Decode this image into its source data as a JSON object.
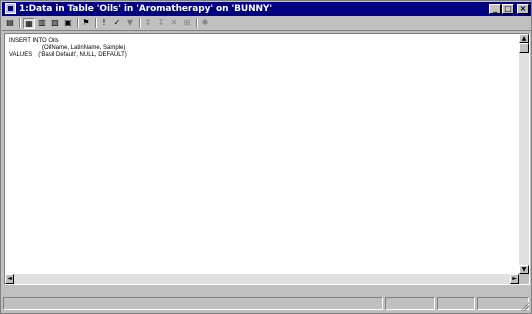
{
  "window": {
    "title": "1:Data in Table 'Oils' in 'Aromatherapy' on 'BUNNY'",
    "title_bar_color": "#000080",
    "buttons": {
      "minimize_icon": "minimize-icon",
      "maximize_icon": "maximize-icon",
      "close_icon": "close-icon"
    }
  },
  "toolbar": {
    "icons": [
      "sql-pane-icon",
      "grid-pane-icon",
      "results-pane-icon",
      "diagram-pane-icon",
      "change-query-type-icon",
      "run-icon",
      "verify-sql-icon",
      "remove-filter-icon",
      "sort-ascending-icon",
      "sort-descending-icon",
      "new-row-icon",
      "properties-icon"
    ]
  },
  "editor": {
    "lines": [
      "INSERT INTO Oils",
      "(OilName, LatinName, Sample)",
      "VALUES",
      "('Basil Default', NULL, DEFAULT)"
    ]
  },
  "status": {
    "panes": [
      "",
      "",
      "",
      ""
    ]
  }
}
